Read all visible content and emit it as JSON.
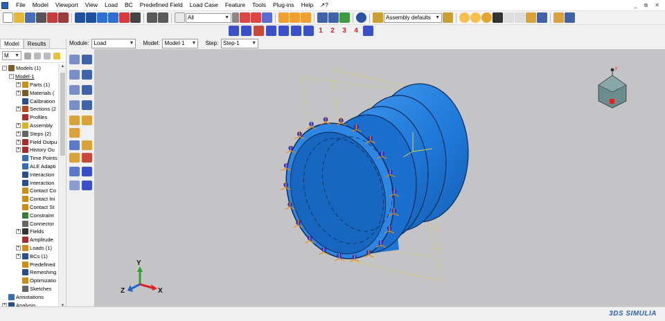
{
  "menu": [
    "File",
    "Model",
    "Viewport",
    "View",
    "Load",
    "BC",
    "Predefined Field",
    "Load Case",
    "Feature",
    "Tools",
    "Plug-ins",
    "Help",
    "↗?"
  ],
  "window_controls": [
    "_",
    "⧉",
    "✕"
  ],
  "toolbar": {
    "selection_filter": "All",
    "render_style": "Assembly defaults",
    "load_case_buttons": [
      "1",
      "2",
      "3",
      "4"
    ]
  },
  "context": {
    "module_label": "Module:",
    "module_value": "Load",
    "model_label": "Model:",
    "model_value": "Model-1",
    "step_label": "Step:",
    "step_value": "Step-1"
  },
  "panel": {
    "tabs": [
      "Model",
      "Results"
    ],
    "tree_filter": "M"
  },
  "tree": [
    {
      "label": "Models (1)",
      "indent": 0,
      "exp": "-",
      "icon": "#7a5b2a"
    },
    {
      "label": "Model-1",
      "indent": 1,
      "exp": "-",
      "icon": "",
      "underline": true
    },
    {
      "label": "Parts (1)",
      "indent": 2,
      "exp": "+",
      "icon": "#c98f1d"
    },
    {
      "label": "Materials (",
      "indent": 2,
      "exp": "+",
      "icon": "#7a5b2a"
    },
    {
      "label": "Calibration",
      "indent": 2,
      "exp": "",
      "icon": "#2a4e8a"
    },
    {
      "label": "Sections (2",
      "indent": 2,
      "exp": "+",
      "icon": "#b34a1e"
    },
    {
      "label": "Profiles",
      "indent": 2,
      "exp": "",
      "icon": "#a33030"
    },
    {
      "label": "Assembly",
      "indent": 2,
      "exp": "+",
      "icon": "#d6b32a"
    },
    {
      "label": "Steps (2)",
      "indent": 2,
      "exp": "+",
      "icon": "#666666"
    },
    {
      "label": "Field Outpu",
      "indent": 2,
      "exp": "+",
      "icon": "#a33030"
    },
    {
      "label": "History Ou",
      "indent": 2,
      "exp": "+",
      "icon": "#a33030"
    },
    {
      "label": "Time Points",
      "indent": 2,
      "exp": "",
      "icon": "#3a6db0"
    },
    {
      "label": "ALE Adapti",
      "indent": 2,
      "exp": "",
      "icon": "#3a6db0"
    },
    {
      "label": "Interaction",
      "indent": 2,
      "exp": "",
      "icon": "#2a4e8a"
    },
    {
      "label": "Interaction",
      "indent": 2,
      "exp": "",
      "icon": "#2a4e8a"
    },
    {
      "label": "Contact Co",
      "indent": 2,
      "exp": "",
      "icon": "#c98f1d"
    },
    {
      "label": "Contact Ini",
      "indent": 2,
      "exp": "",
      "icon": "#c98f1d"
    },
    {
      "label": "Contact St",
      "indent": 2,
      "exp": "",
      "icon": "#c98f1d"
    },
    {
      "label": "Constraint",
      "indent": 2,
      "exp": "",
      "icon": "#3a7a3a"
    },
    {
      "label": "Connector",
      "indent": 2,
      "exp": "",
      "icon": "#666666"
    },
    {
      "label": "Fields",
      "indent": 2,
      "exp": "+",
      "icon": "#333333"
    },
    {
      "label": "Amplitude",
      "indent": 2,
      "exp": "",
      "icon": "#a33030"
    },
    {
      "label": "Loads (1)",
      "indent": 2,
      "exp": "+",
      "icon": "#c98f1d"
    },
    {
      "label": "BCs (1)",
      "indent": 2,
      "exp": "+",
      "icon": "#2a4e8a"
    },
    {
      "label": "Predefined",
      "indent": 2,
      "exp": "",
      "icon": "#c98f1d"
    },
    {
      "label": "Remeshing",
      "indent": 2,
      "exp": "",
      "icon": "#2a4e8a"
    },
    {
      "label": "Optimizatio",
      "indent": 2,
      "exp": "",
      "icon": "#c98f1d"
    },
    {
      "label": "Sketches",
      "indent": 2,
      "exp": "",
      "icon": "#666666"
    },
    {
      "label": "Annotations",
      "indent": 0,
      "exp": "",
      "icon": "#3a6db0"
    },
    {
      "label": "Analysis",
      "indent": 0,
      "exp": "+",
      "icon": "#2a4e8a"
    }
  ],
  "viewport": {
    "triad_labels": {
      "x": "X",
      "y": "Y",
      "z": "Z"
    },
    "view_cube_label": "view-cube"
  },
  "brand": "3DS SIMULIA",
  "colors": {
    "part_blue": "#1f78d8",
    "viewport_bg": "#c4c4c6",
    "bc_marker": "#3a3ad6",
    "load_marker": "#e8891c"
  }
}
